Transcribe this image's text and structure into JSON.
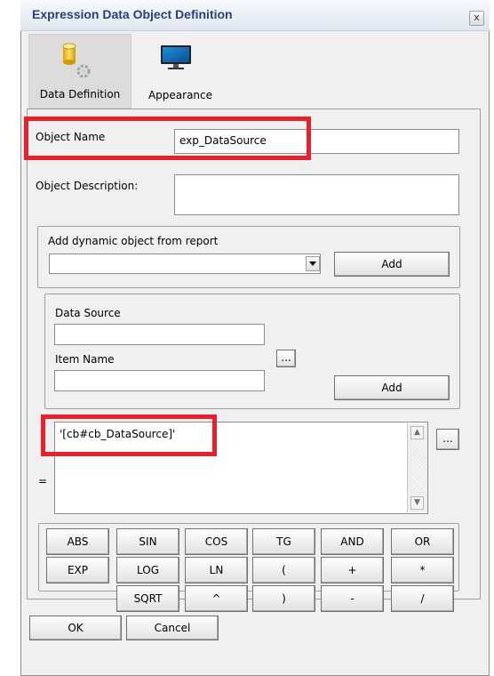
{
  "window": {
    "title": "Expression Data Object Definition",
    "close_label": "x"
  },
  "tabs": [
    {
      "label": "Data Definition",
      "icon": "database-gear-icon",
      "selected": true
    },
    {
      "label": "Appearance",
      "icon": "monitor-icon",
      "selected": false
    }
  ],
  "object_name": {
    "label": "Object Name",
    "value": "exp_DataSource"
  },
  "object_description": {
    "label": "Object Description:",
    "value": ""
  },
  "dynamic_object": {
    "label": "Add dynamic object from report",
    "selected": "",
    "add_label": "Add"
  },
  "data_source_group": {
    "data_source_label": "Data Source",
    "data_source_value": "",
    "item_name_label": "Item Name",
    "item_name_value": "",
    "browse_label": "...",
    "add_label": "Add"
  },
  "expression": {
    "equals": "=",
    "value": "'[cb#cb_DataSource]'",
    "browse_label": "..."
  },
  "functions": [
    [
      "ABS",
      "SIN",
      "COS",
      "TG",
      "AND",
      "OR"
    ],
    [
      "EXP",
      "LOG",
      "LN",
      "(",
      "+",
      "*"
    ],
    [
      "",
      "SQRT",
      "^",
      ")",
      "-",
      "/"
    ]
  ],
  "footer": {
    "ok_label": "OK",
    "cancel_label": "Cancel"
  },
  "colors": {
    "highlight": "#e8202a",
    "title_text": "#2a3e7a"
  }
}
